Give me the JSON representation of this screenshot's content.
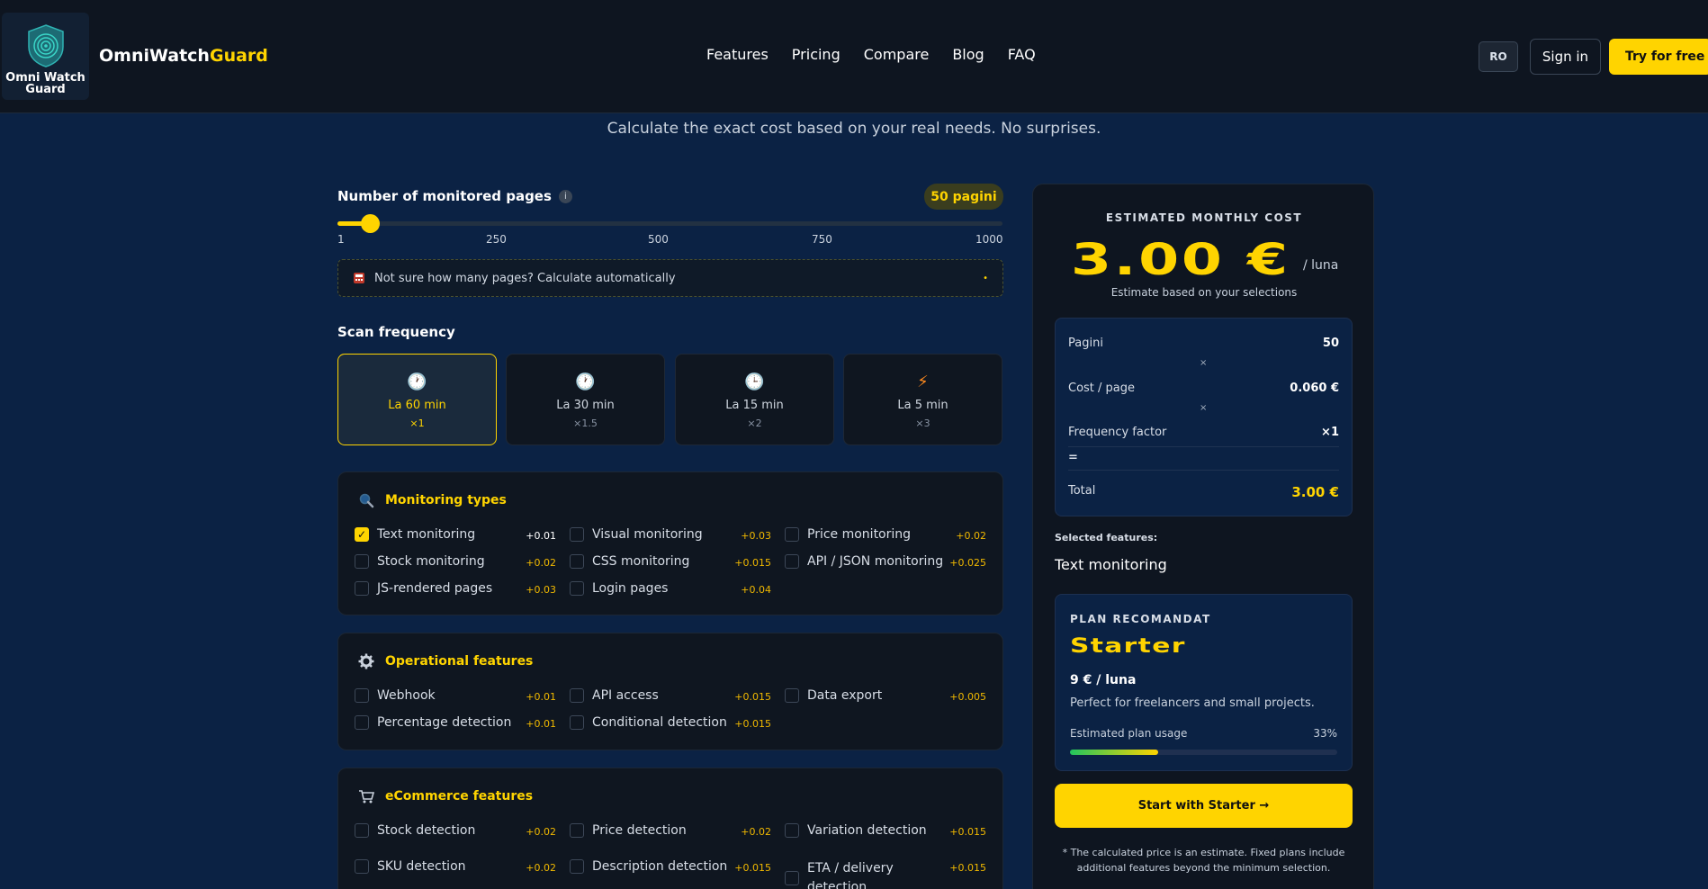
{
  "header": {
    "logo_text_line1": "Omni Watch",
    "logo_text_line2": "Guard",
    "brand_white": "OmniWatch",
    "brand_gold": "Guard",
    "nav": [
      "Features",
      "Pricing",
      "Compare",
      "Blog",
      "FAQ"
    ],
    "lang": "RO",
    "signin": "Sign in",
    "try": "Try for free"
  },
  "subtitle": "Calculate the exact cost based on your real needs. No surprises.",
  "pages": {
    "label": "Number of monitored pages",
    "info": "i",
    "badge": "50 pagini",
    "value": 50,
    "min": 1,
    "max": 1000,
    "ticks": [
      "1",
      "250",
      "500",
      "750",
      "1000"
    ],
    "calc_text": "Not sure how many pages? Calculate automatically",
    "calc_dot": "•"
  },
  "scan": {
    "label": "Scan frequency",
    "options": [
      {
        "name": "La 60 min",
        "mult": "×1",
        "icon": "clock-icon",
        "glyph": "🕐",
        "active": true
      },
      {
        "name": "La 30 min",
        "mult": "×1.5",
        "icon": "clock-icon",
        "glyph": "🕐",
        "active": false
      },
      {
        "name": "La 15 min",
        "mult": "×2",
        "icon": "clock-icon",
        "glyph": "🕒",
        "active": false
      },
      {
        "name": "La 5 min",
        "mult": "×3",
        "icon": "lightning-icon",
        "glyph": "⚡",
        "active": false
      }
    ]
  },
  "monitoring": {
    "title": "Monitoring types",
    "items": [
      {
        "label": "Text monitoring",
        "price": "+0.01",
        "checked": true
      },
      {
        "label": "Visual monitoring",
        "price": "+0.03",
        "checked": false
      },
      {
        "label": "Price monitoring",
        "price": "+0.02",
        "checked": false
      },
      {
        "label": "Stock monitoring",
        "price": "+0.02",
        "checked": false
      },
      {
        "label": "CSS monitoring",
        "price": "+0.015",
        "checked": false
      },
      {
        "label": "API / JSON monitoring",
        "price": "+0.025",
        "checked": false
      },
      {
        "label": "JS-rendered pages",
        "price": "+0.03",
        "checked": false
      },
      {
        "label": "Login pages",
        "price": "+0.04",
        "checked": false
      }
    ]
  },
  "operational": {
    "title": "Operational features",
    "items": [
      {
        "label": "Webhook",
        "price": "+0.01"
      },
      {
        "label": "API access",
        "price": "+0.015"
      },
      {
        "label": "Data export",
        "price": "+0.005"
      },
      {
        "label": "Percentage detection",
        "price": "+0.01"
      },
      {
        "label": "Conditional detection",
        "price": "+0.015"
      }
    ]
  },
  "ecommerce": {
    "title": "eCommerce features",
    "items": [
      {
        "label": "Stock detection",
        "price": "+0.02"
      },
      {
        "label": "Price detection",
        "price": "+0.02"
      },
      {
        "label": "Variation detection",
        "price": "+0.015"
      },
      {
        "label": "SKU detection",
        "price": "+0.02"
      },
      {
        "label": "Description detection",
        "price": "+0.015"
      },
      {
        "label": "ETA / delivery detection",
        "price": "+0.015"
      }
    ]
  },
  "cost": {
    "title": "ESTIMATED MONTHLY COST",
    "amount": "3.00 €",
    "per": "/ luna",
    "note": "Estimate based on your selections",
    "rows": {
      "pages_label": "Pagini",
      "pages_value": "50",
      "cpp_label": "Cost / page",
      "cpp_value": "0.060 €",
      "freq_label": "Frequency factor",
      "freq_value": "×1",
      "times": "×",
      "equals": "=",
      "total_label": "Total",
      "total_value": "3.00 €"
    },
    "selected_label": "Selected features:",
    "selected_value": "Text monitoring",
    "plan": {
      "heading": "PLAN RECOMANDAT",
      "name": "Starter",
      "price": "9 € / luna",
      "desc": "Perfect for freelancers and small projects.",
      "usage_label": "Estimated plan usage",
      "usage_pct": "33%",
      "usage_value": 0.33
    },
    "cta": "Start with Starter →",
    "footnote": "* The calculated price is an estimate. Fixed plans include additional features beyond the minimum selection."
  },
  "colors": {
    "accent": "#ffd400",
    "bg": "#0b2244",
    "panel": "#0f1620"
  }
}
